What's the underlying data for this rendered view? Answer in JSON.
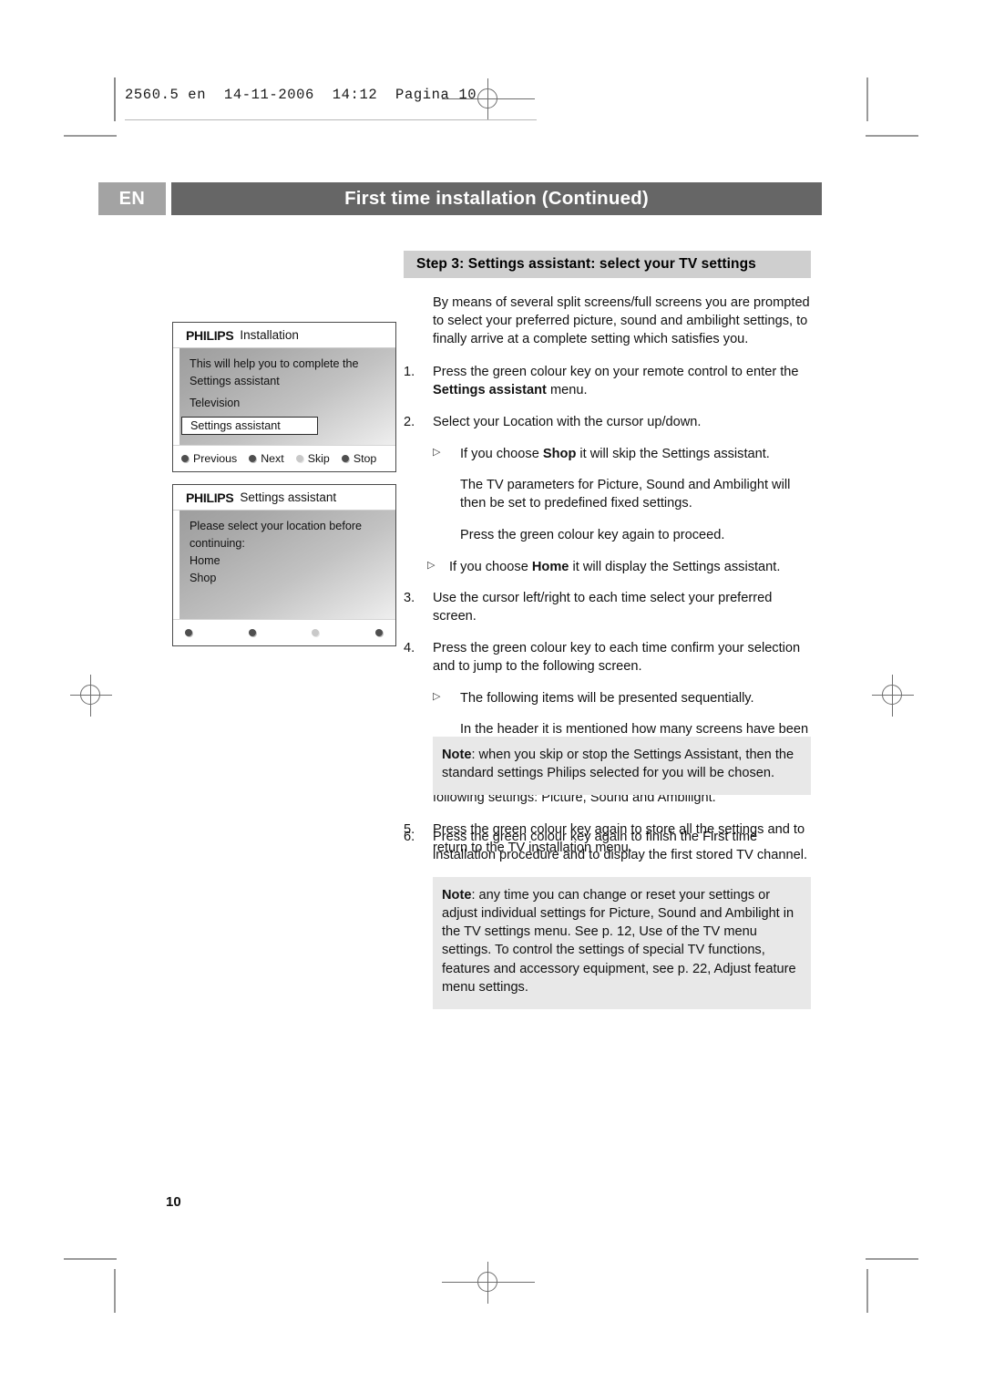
{
  "print_slug": "2560.5 en  14-11-2006  14:12  Pagina 10",
  "header": {
    "language_code": "EN",
    "title": "First time installation  (Continued)"
  },
  "step_header": "Step 3: Settings assistant: select your TV settings",
  "tv_screens": [
    {
      "brand": "PHILIPS",
      "title": "Installation",
      "lines": [
        "This will help you to complete the Settings assistant",
        "Television"
      ],
      "highlighted_item": "Settings assistant",
      "footer_buttons": [
        {
          "label": "Previous",
          "dot": "dot-dark"
        },
        {
          "label": "Next",
          "dot": "dot-dark"
        },
        {
          "label": "Skip",
          "dot": "dot-light"
        },
        {
          "label": "Stop",
          "dot": "dot-dark"
        }
      ]
    },
    {
      "brand": "PHILIPS",
      "title": "Settings assistant",
      "lines": [
        "Please select your location before",
        "continuing:",
        "Home",
        "Shop"
      ],
      "footer_buttons": [
        {
          "label": "",
          "dot": "dot-dark"
        },
        {
          "label": "",
          "dot": "dot-dark"
        },
        {
          "label": "",
          "dot": "dot-light"
        },
        {
          "label": "",
          "dot": "dot-dark"
        }
      ]
    }
  ],
  "intro_paragraph": "By means of several split screens/full screens you are prompted to select your preferred picture, sound and ambilight settings, to finally arrive at a complete setting which satisfies you.",
  "steps": {
    "s1_num": "1.",
    "s1_pre": "Press the green colour key on your remote control to enter the ",
    "s1_bold": "Settings assistant",
    "s1_post": " menu.",
    "s2_num": "2.",
    "s2_text": "Select your Location with the cursor up/down.",
    "s2_sub1_pre": "If you choose ",
    "s2_sub1_bold": "Shop",
    "s2_sub1_post": " it will skip the Settings assistant.",
    "s2_sub1_cont1": "The TV parameters for Picture, Sound and Ambilight will then be set to predefined fixed settings.",
    "s2_sub1_cont2": "Press the green colour key again to proceed.",
    "s2_sub2_pre": "If you choose ",
    "s2_sub2_bold": "Home",
    "s2_sub2_post": " it will display the Settings assistant.",
    "s3_num": "3.",
    "s3_text": "Use the cursor left/right to each time select your preferred screen.",
    "s4_num": "4.",
    "s4_text": "Press the green colour key to each time confirm your selection and to jump to the following screen.",
    "s4_sub1": "The following items will be presented sequentially.",
    "s4_sub1_cont": "In the header it is mentioned how many screens have been completed and how many screens there are in total.",
    "s4_after": "The Settings assistant will step sequentially through the following settings: Picture, Sound and Ambilight.",
    "s5_num": "5.",
    "s5_text": "Press the green colour key again to store all the settings and to return to the TV installation menu.",
    "s6_num": "6.",
    "s6_text": "Press the green colour key again to finish the First time installation procedure and to display the first stored TV channel."
  },
  "notes": [
    {
      "label": "Note",
      "body": ": when you skip or stop the Settings Assistant, then the standard settings Philips selected for you will be chosen."
    },
    {
      "label": "Note",
      "body": ": any time you can change or reset your settings or adjust individual settings for Picture, Sound and Ambilight in the TV settings menu. See p. 12, Use of the TV menu settings.",
      "body2": "To control the settings of special TV functions, features and accessory equipment, see p. 22,  Adjust feature menu settings."
    }
  ],
  "page_number": "10"
}
